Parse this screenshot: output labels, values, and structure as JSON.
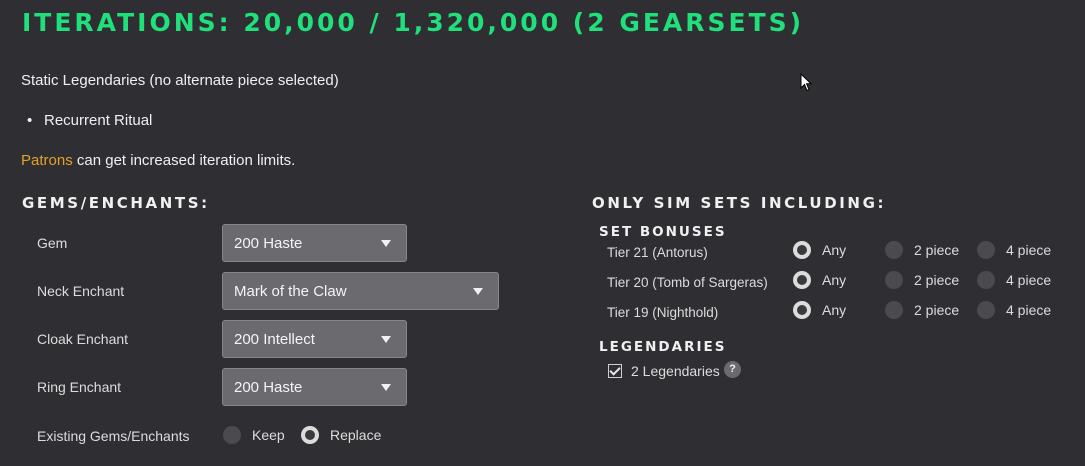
{
  "header": {
    "title": "ITERATIONS: 20,000 / 1,320,000 (2 GEARSETS)"
  },
  "info": {
    "static_legendaries": "Static Legendaries (no alternate piece selected)",
    "legendary_items": [
      "Recurrent Ritual"
    ],
    "patrons_link": "Patrons",
    "patrons_text": " can get increased iteration limits."
  },
  "gems_enchants": {
    "heading": "GEMS/ENCHANTS:",
    "rows": [
      {
        "label": "Gem",
        "value": "200 Haste"
      },
      {
        "label": "Neck Enchant",
        "value": "Mark of the Claw"
      },
      {
        "label": "Cloak Enchant",
        "value": "200 Intellect"
      },
      {
        "label": "Ring Enchant",
        "value": "200 Haste"
      }
    ],
    "existing": {
      "label": "Existing Gems/Enchants",
      "options": [
        "Keep",
        "Replace"
      ],
      "selected": "Replace"
    }
  },
  "sim_sets": {
    "heading": "ONLY SIM SETS INCLUDING:",
    "set_bonuses_heading": "SET BONUSES",
    "option_labels": [
      "Any",
      "2 piece",
      "4 piece"
    ],
    "sets": [
      {
        "label": "Tier 21 (Antorus)",
        "selected": "Any"
      },
      {
        "label": "Tier 20 (Tomb of Sargeras)",
        "selected": "Any"
      },
      {
        "label": "Tier 19 (Nighthold)",
        "selected": "Any"
      }
    ],
    "legendaries_heading": "LEGENDARIES",
    "legendaries_checkbox_label": "2 Legendaries",
    "legendaries_checked": true,
    "help_icon": "?"
  }
}
